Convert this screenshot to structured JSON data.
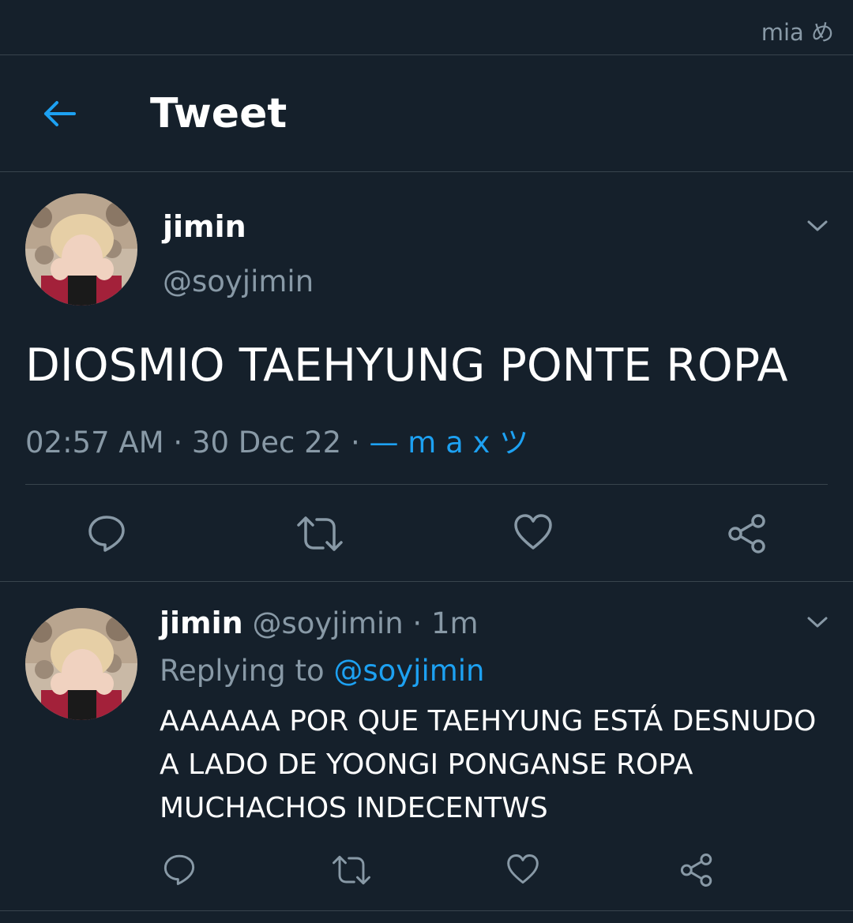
{
  "status_bar": {
    "tag": "mia め"
  },
  "header": {
    "title": "Tweet"
  },
  "tweet": {
    "display_name": "jimin",
    "handle": "@soyjimin",
    "text": "DIOSMIO TAEHYUNG PONTE ROPA",
    "time": "02:57 AM",
    "separator": " · ",
    "date": "30 Dec 22",
    "source": "— m a x ツ"
  },
  "reply": {
    "display_name": "jimin",
    "handle": "@soyjimin",
    "age": "1m",
    "separator": " · ",
    "replying_prefix": "Replying to ",
    "replying_to": "@soyjimin",
    "text": "AAAAAA POR QUE TAEHYUNG ESTÁ DESNUDO A LADO DE YOONGI PONGANSE ROPA MUCHACHOS INDECENTWS"
  },
  "icons": {
    "back": "arrow-left-icon",
    "menu": "chevron-down-icon",
    "reply": "speech-bubble-icon",
    "retweet": "retweet-icon",
    "like": "heart-icon",
    "share": "share-icon"
  },
  "colors": {
    "background": "#15202b",
    "accent": "#1da1f2",
    "muted": "#8899a6",
    "divider": "#38444d"
  }
}
